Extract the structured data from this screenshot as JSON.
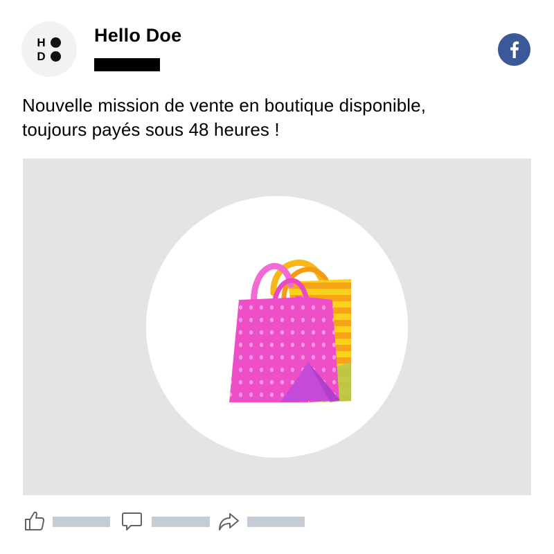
{
  "header": {
    "avatar_letters": [
      "H",
      "D"
    ],
    "author_name": "Hello Doe"
  },
  "post": {
    "text_lines": [
      "Nouvelle mission de vente en boutique disponible,",
      "toujours payés sous 48 heures !"
    ]
  },
  "media": {
    "emoji": "shopping-bags-icon"
  },
  "actions": [
    {
      "icon": "like-icon"
    },
    {
      "icon": "comment-icon"
    },
    {
      "icon": "share-icon"
    }
  ],
  "colors": {
    "facebook_blue": "#3b5998",
    "media_background": "#e4e4e6",
    "placeholder_gray": "#c5ccd3",
    "icon_gray": "#5f6368"
  }
}
